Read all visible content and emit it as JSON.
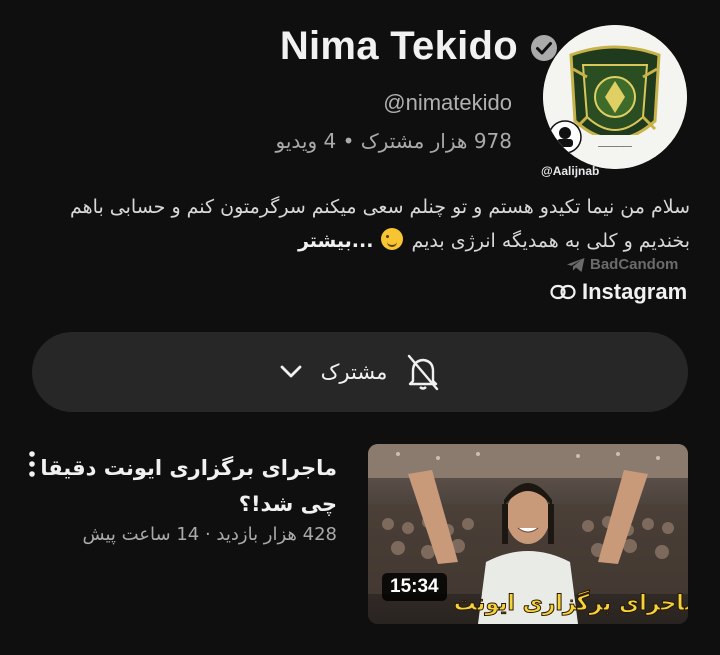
{
  "channel": {
    "name": "Nima Tekido",
    "handle": "@nimatekido",
    "meta": "978 هزار مشترک • 4 ویدیو",
    "avatar_overlay": "@Aalijnab"
  },
  "description": {
    "text": "سلام من نیما تکیدو هستم و تو چنلم سعی میکنم سرگرمتون کنم و حسابی باهم بخندیم و کلی به همدیگه انرژی بدیم",
    "more_label": "...بیشتر"
  },
  "watermark": "BadCandom",
  "link": {
    "label": "Instagram"
  },
  "subscribe": {
    "label": "مشترک"
  },
  "video": {
    "title": "ماجرای برگزاری ایونت دقیقا چی شد!؟",
    "meta": "428 هزار بازدید · 14 ساعت پیش",
    "duration": "15:34",
    "thumb_caption": "ماجرای برگزاری ایونت"
  },
  "colors": {
    "background": "#0f0f0f",
    "surface": "#272727",
    "text_primary": "#f1f1f1",
    "text_secondary": "#aaaaaa"
  },
  "icons": [
    "verified-icon",
    "link-icon",
    "bell-off-icon",
    "chevron-down-icon",
    "more-vert-icon",
    "telegram-icon"
  ]
}
